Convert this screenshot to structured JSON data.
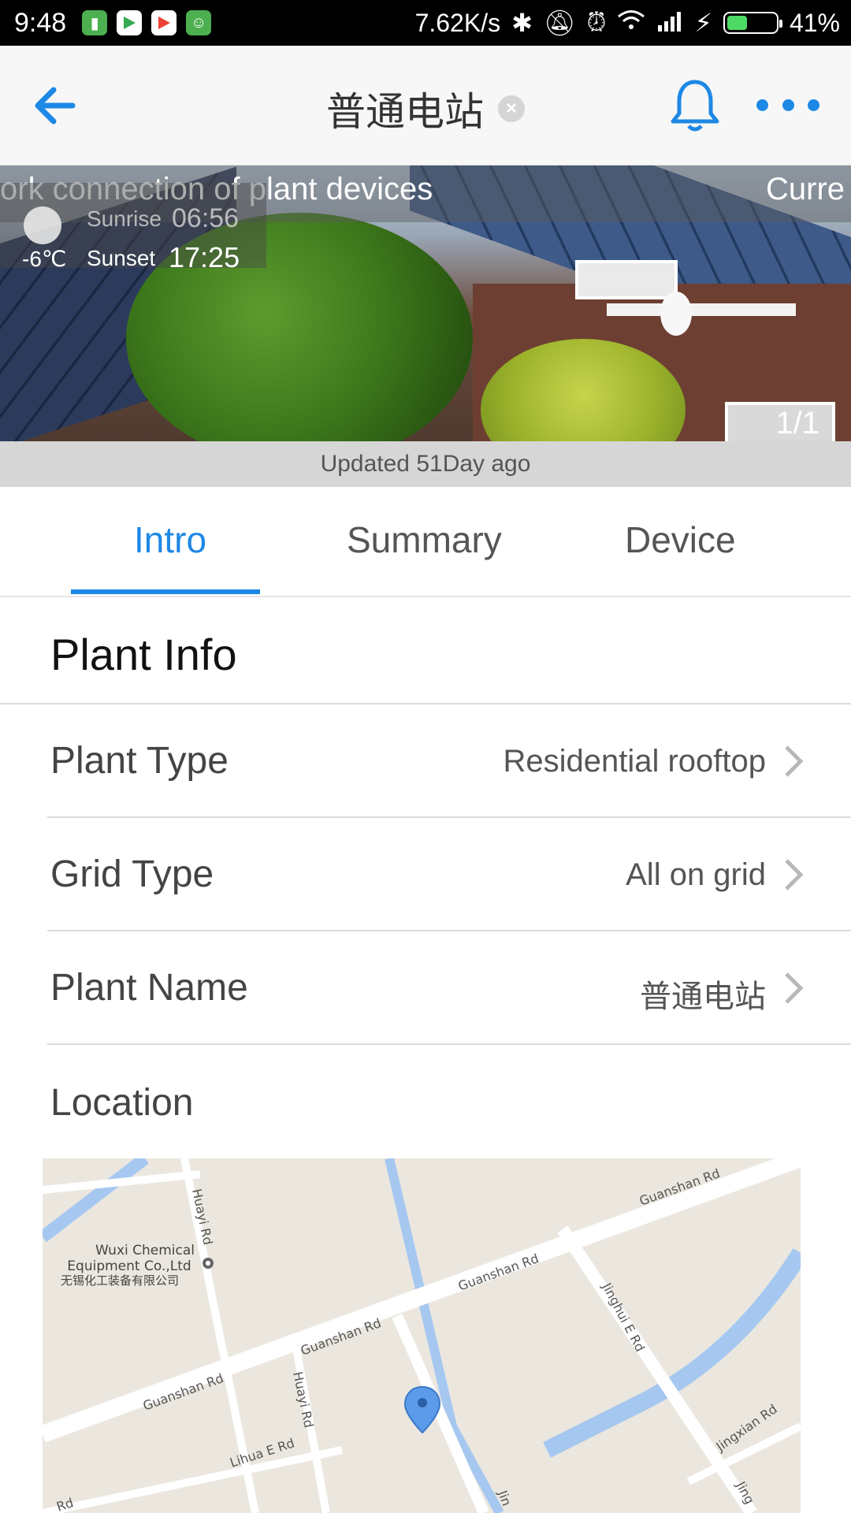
{
  "status_bar": {
    "time": "9:48",
    "speed": "7.62K/s",
    "battery_percent": "41%",
    "battery_level": 0.41
  },
  "header": {
    "title": "普通电站",
    "icons": [
      "back-arrow-icon",
      "clear-icon",
      "bell-icon",
      "more-icon"
    ]
  },
  "banner": {
    "marquee_text": "ork connection of plant devices",
    "marquee_text_right": "Curre",
    "sunrise_label": "Sunrise",
    "sunrise_time": "06:56",
    "temperature": "-6℃",
    "sunset_label": "Sunset",
    "sunset_time": "17:25",
    "page_indicator": "1/1"
  },
  "updated_text": "Updated 51Day ago",
  "tabs": [
    {
      "label": "Intro",
      "active": true
    },
    {
      "label": "Summary",
      "active": false
    },
    {
      "label": "Device",
      "active": false
    }
  ],
  "plant_info": {
    "section_title": "Plant Info",
    "rows": [
      {
        "label": "Plant Type",
        "value": "Residential rooftop"
      },
      {
        "label": "Grid Type",
        "value": "All on grid"
      },
      {
        "label": "Plant Name",
        "value": "普通电站"
      }
    ],
    "location_label": "Location"
  },
  "map": {
    "poi_name_en_1": "Wuxi Chemical",
    "poi_name_en_2": "Equipment Co.,Ltd",
    "poi_name_cn": "无锡化工装备有限公司",
    "roads": {
      "huayi_rd_1": "Huayi Rd",
      "huayi_rd_2": "Huayi Rd",
      "guanshan_rd_1": "Guanshan Rd",
      "guanshan_rd_2": "Guanshan Rd",
      "guanshan_rd_3": "Guanshan Rd",
      "guanshan_rd_4": "Guanshan Rd",
      "jinghui_e_rd": "Jinghui E Rd",
      "lihua_e_rd": "Lihua E Rd",
      "jingxian_rd": "Jingxian Rd",
      "rd_fragment": "Rd",
      "jin_fragment_1": "Jin",
      "jin_fragment_2": "Jing"
    }
  }
}
